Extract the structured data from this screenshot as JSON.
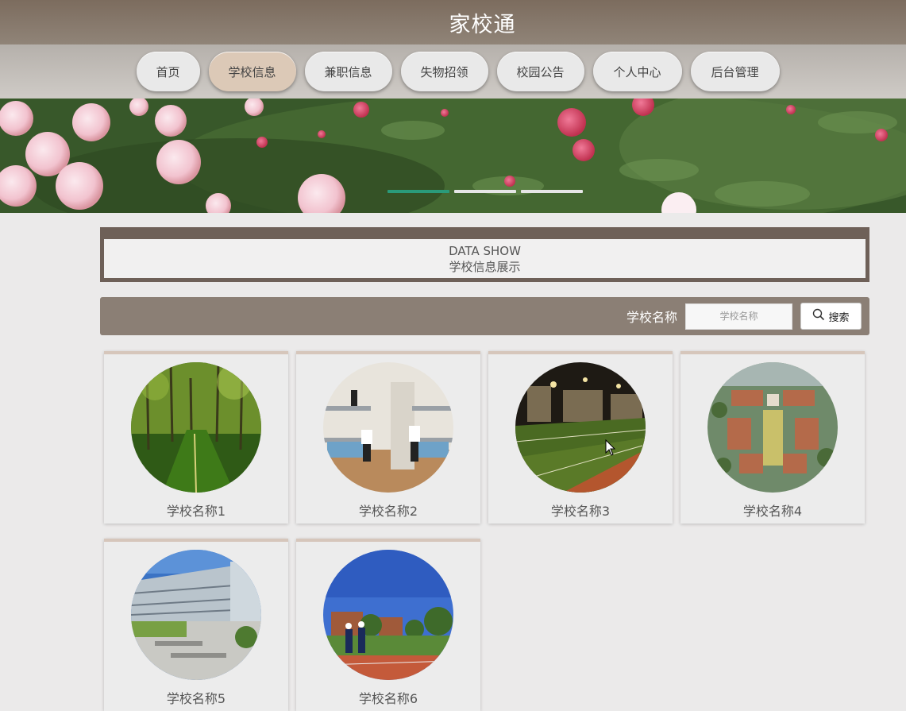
{
  "header": {
    "title": "家校通"
  },
  "nav": {
    "items": [
      {
        "label": "首页",
        "active": false
      },
      {
        "label": "学校信息",
        "active": true
      },
      {
        "label": "兼职信息",
        "active": false
      },
      {
        "label": "失物招领",
        "active": false
      },
      {
        "label": "校园公告",
        "active": false
      },
      {
        "label": "个人中心",
        "active": false
      },
      {
        "label": "后台管理",
        "active": false
      }
    ]
  },
  "banner": {
    "slide_count": 3,
    "active_slide": 1,
    "accent_color": "#2a9a7a"
  },
  "section": {
    "title_en": "DATA SHOW",
    "title_cn": "学校信息展示"
  },
  "search": {
    "label": "学校名称",
    "placeholder": "学校名称",
    "button_label": "搜索",
    "button_icon": "search-icon"
  },
  "schools": [
    {
      "name": "学校名称1"
    },
    {
      "name": "学校名称2"
    },
    {
      "name": "学校名称3"
    },
    {
      "name": "学校名称4"
    },
    {
      "name": "学校名称5"
    },
    {
      "name": "学校名称6"
    }
  ],
  "colors": {
    "header": "#7c6c5e",
    "nav_active": "#dcc9b7",
    "section_border": "#6e6058",
    "search_bar": "#8b7f75"
  }
}
